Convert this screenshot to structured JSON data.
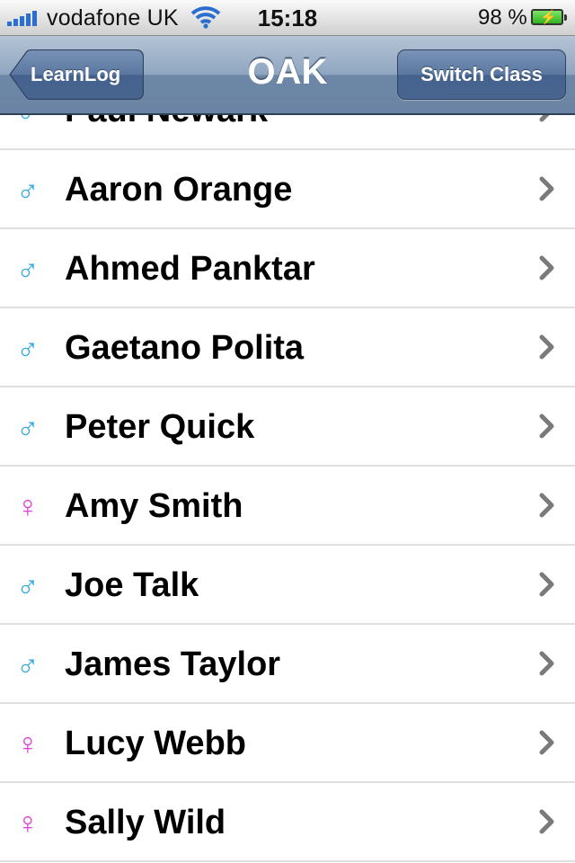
{
  "status_bar": {
    "carrier": "vodafone UK",
    "time": "15:18",
    "battery_percent": "98 %",
    "battery_level": 0.98,
    "signal_bars": 5
  },
  "nav": {
    "back_label": "LearnLog",
    "title": "OAK",
    "right_button_label": "Switch Class"
  },
  "colors": {
    "male": "#2ea7e6",
    "female": "#e23fd8"
  },
  "students": [
    {
      "name": "Paul Newark",
      "gender": "male",
      "icon": "male-icon"
    },
    {
      "name": "Aaron Orange",
      "gender": "male",
      "icon": "male-icon"
    },
    {
      "name": "Ahmed Panktar",
      "gender": "male",
      "icon": "male-icon"
    },
    {
      "name": "Gaetano Polita",
      "gender": "male",
      "icon": "male-icon"
    },
    {
      "name": "Peter Quick",
      "gender": "male",
      "icon": "male-icon"
    },
    {
      "name": "Amy Smith",
      "gender": "female",
      "icon": "female-icon"
    },
    {
      "name": "Joe Talk",
      "gender": "male",
      "icon": "male-icon"
    },
    {
      "name": "James Taylor",
      "gender": "male",
      "icon": "male-icon"
    },
    {
      "name": "Lucy Webb",
      "gender": "female",
      "icon": "female-icon"
    },
    {
      "name": "Sally Wild",
      "gender": "female",
      "icon": "female-icon"
    }
  ]
}
